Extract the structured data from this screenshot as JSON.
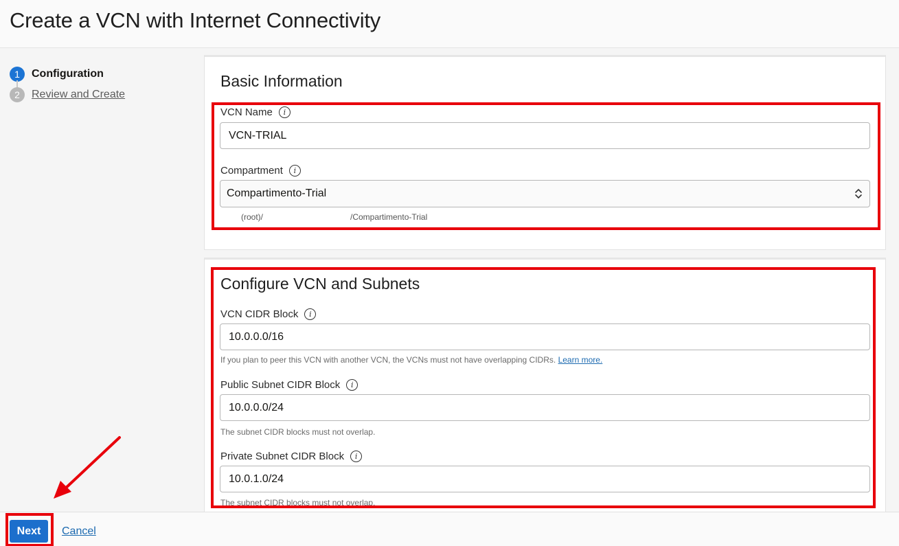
{
  "page": {
    "title": "Create a VCN with Internet Connectivity"
  },
  "steps": [
    {
      "number": "1",
      "label": "Configuration"
    },
    {
      "number": "2",
      "label": "Review and Create"
    }
  ],
  "basic_info": {
    "title": "Basic Information",
    "vcn_name": {
      "label": "VCN Name",
      "value": "VCN-TRIAL"
    },
    "compartment": {
      "label": "Compartment",
      "value": "Compartimento-Trial",
      "path_prefix": "(root)/",
      "path_suffix": "/Compartimento-Trial"
    }
  },
  "vcn_subnets": {
    "title": "Configure VCN and Subnets",
    "vcn_cidr": {
      "label": "VCN CIDR Block",
      "value": "10.0.0.0/16",
      "help": "If you plan to peer this VCN with another VCN, the VCNs must not have overlapping CIDRs.",
      "help_link": "Learn more."
    },
    "public_subnet": {
      "label": "Public Subnet CIDR Block",
      "value": "10.0.0.0/24",
      "help": "The subnet CIDR blocks must not overlap."
    },
    "private_subnet": {
      "label": "Private Subnet CIDR Block",
      "value": "10.0.1.0/24",
      "help": "The subnet CIDR blocks must not overlap."
    }
  },
  "footer": {
    "next_label": "Next",
    "cancel_label": "Cancel"
  },
  "colors": {
    "primary": "#1c6fcc",
    "annotation": "#e8000b",
    "link": "#1c6ab0"
  }
}
